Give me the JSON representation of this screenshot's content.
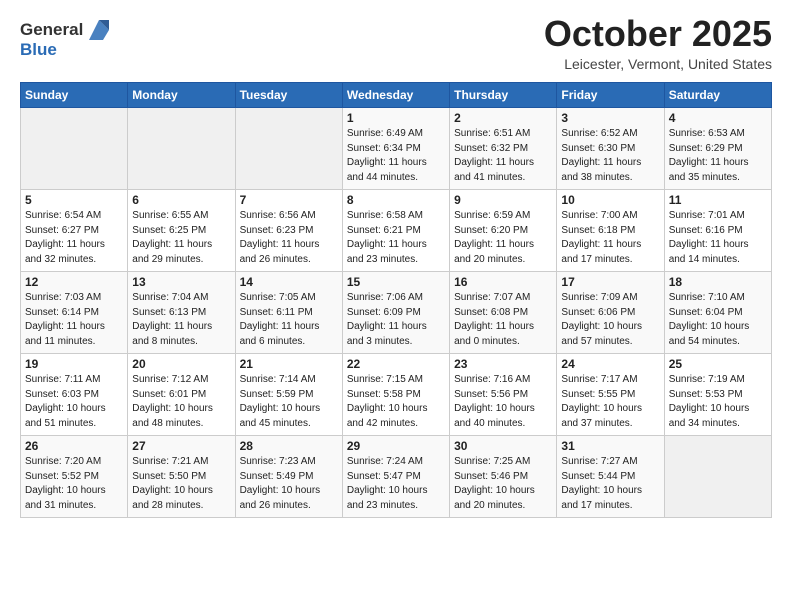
{
  "header": {
    "logo_general": "General",
    "logo_blue": "Blue",
    "title": "October 2025",
    "location": "Leicester, Vermont, United States"
  },
  "weekdays": [
    "Sunday",
    "Monday",
    "Tuesday",
    "Wednesday",
    "Thursday",
    "Friday",
    "Saturday"
  ],
  "weeks": [
    [
      {
        "day": "",
        "empty": true
      },
      {
        "day": "",
        "empty": true
      },
      {
        "day": "",
        "empty": true
      },
      {
        "day": "1",
        "sunrise": "6:49 AM",
        "sunset": "6:34 PM",
        "daylight": "11 hours and 44 minutes."
      },
      {
        "day": "2",
        "sunrise": "6:51 AM",
        "sunset": "6:32 PM",
        "daylight": "11 hours and 41 minutes."
      },
      {
        "day": "3",
        "sunrise": "6:52 AM",
        "sunset": "6:30 PM",
        "daylight": "11 hours and 38 minutes."
      },
      {
        "day": "4",
        "sunrise": "6:53 AM",
        "sunset": "6:29 PM",
        "daylight": "11 hours and 35 minutes."
      }
    ],
    [
      {
        "day": "5",
        "sunrise": "6:54 AM",
        "sunset": "6:27 PM",
        "daylight": "11 hours and 32 minutes."
      },
      {
        "day": "6",
        "sunrise": "6:55 AM",
        "sunset": "6:25 PM",
        "daylight": "11 hours and 29 minutes."
      },
      {
        "day": "7",
        "sunrise": "6:56 AM",
        "sunset": "6:23 PM",
        "daylight": "11 hours and 26 minutes."
      },
      {
        "day": "8",
        "sunrise": "6:58 AM",
        "sunset": "6:21 PM",
        "daylight": "11 hours and 23 minutes."
      },
      {
        "day": "9",
        "sunrise": "6:59 AM",
        "sunset": "6:20 PM",
        "daylight": "11 hours and 20 minutes."
      },
      {
        "day": "10",
        "sunrise": "7:00 AM",
        "sunset": "6:18 PM",
        "daylight": "11 hours and 17 minutes."
      },
      {
        "day": "11",
        "sunrise": "7:01 AM",
        "sunset": "6:16 PM",
        "daylight": "11 hours and 14 minutes."
      }
    ],
    [
      {
        "day": "12",
        "sunrise": "7:03 AM",
        "sunset": "6:14 PM",
        "daylight": "11 hours and 11 minutes."
      },
      {
        "day": "13",
        "sunrise": "7:04 AM",
        "sunset": "6:13 PM",
        "daylight": "11 hours and 8 minutes."
      },
      {
        "day": "14",
        "sunrise": "7:05 AM",
        "sunset": "6:11 PM",
        "daylight": "11 hours and 6 minutes."
      },
      {
        "day": "15",
        "sunrise": "7:06 AM",
        "sunset": "6:09 PM",
        "daylight": "11 hours and 3 minutes."
      },
      {
        "day": "16",
        "sunrise": "7:07 AM",
        "sunset": "6:08 PM",
        "daylight": "11 hours and 0 minutes."
      },
      {
        "day": "17",
        "sunrise": "7:09 AM",
        "sunset": "6:06 PM",
        "daylight": "10 hours and 57 minutes."
      },
      {
        "day": "18",
        "sunrise": "7:10 AM",
        "sunset": "6:04 PM",
        "daylight": "10 hours and 54 minutes."
      }
    ],
    [
      {
        "day": "19",
        "sunrise": "7:11 AM",
        "sunset": "6:03 PM",
        "daylight": "10 hours and 51 minutes."
      },
      {
        "day": "20",
        "sunrise": "7:12 AM",
        "sunset": "6:01 PM",
        "daylight": "10 hours and 48 minutes."
      },
      {
        "day": "21",
        "sunrise": "7:14 AM",
        "sunset": "5:59 PM",
        "daylight": "10 hours and 45 minutes."
      },
      {
        "day": "22",
        "sunrise": "7:15 AM",
        "sunset": "5:58 PM",
        "daylight": "10 hours and 42 minutes."
      },
      {
        "day": "23",
        "sunrise": "7:16 AM",
        "sunset": "5:56 PM",
        "daylight": "10 hours and 40 minutes."
      },
      {
        "day": "24",
        "sunrise": "7:17 AM",
        "sunset": "5:55 PM",
        "daylight": "10 hours and 37 minutes."
      },
      {
        "day": "25",
        "sunrise": "7:19 AM",
        "sunset": "5:53 PM",
        "daylight": "10 hours and 34 minutes."
      }
    ],
    [
      {
        "day": "26",
        "sunrise": "7:20 AM",
        "sunset": "5:52 PM",
        "daylight": "10 hours and 31 minutes."
      },
      {
        "day": "27",
        "sunrise": "7:21 AM",
        "sunset": "5:50 PM",
        "daylight": "10 hours and 28 minutes."
      },
      {
        "day": "28",
        "sunrise": "7:23 AM",
        "sunset": "5:49 PM",
        "daylight": "10 hours and 26 minutes."
      },
      {
        "day": "29",
        "sunrise": "7:24 AM",
        "sunset": "5:47 PM",
        "daylight": "10 hours and 23 minutes."
      },
      {
        "day": "30",
        "sunrise": "7:25 AM",
        "sunset": "5:46 PM",
        "daylight": "10 hours and 20 minutes."
      },
      {
        "day": "31",
        "sunrise": "7:27 AM",
        "sunset": "5:44 PM",
        "daylight": "10 hours and 17 minutes."
      },
      {
        "day": "",
        "empty": true
      }
    ]
  ]
}
